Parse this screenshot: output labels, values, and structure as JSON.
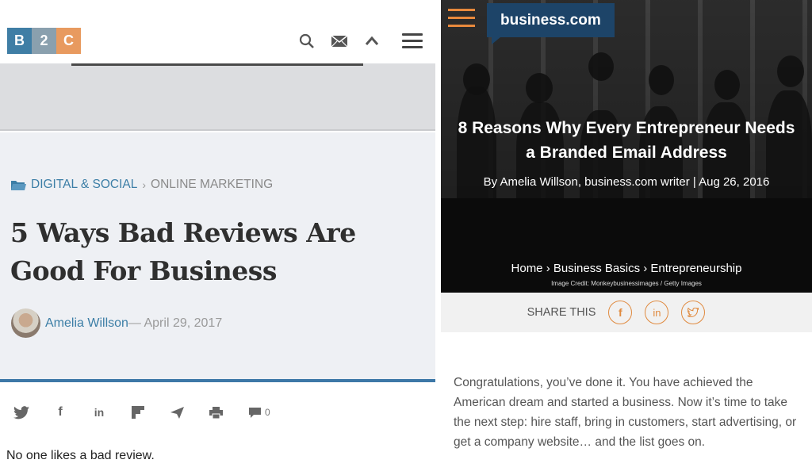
{
  "left": {
    "logo": {
      "b": "B",
      "two": "2",
      "c": "C"
    },
    "header_icons": [
      "search-icon",
      "mail-icon",
      "chevron-up-icon",
      "menu-icon"
    ],
    "breadcrumb": {
      "category": "DIGITAL & SOCIAL",
      "separator": "›",
      "subcategory": "ONLINE MARKETING"
    },
    "headline": "5 Ways Bad Reviews Are Good For Business",
    "author": "Amelia Willson",
    "date": "— April 29, 2017",
    "share_icons": [
      "twitter-icon",
      "facebook-icon",
      "linkedin-icon",
      "flipboard-icon",
      "send-icon",
      "print-icon",
      "comment-icon"
    ],
    "comment_count": "0",
    "teaser": "No one likes a bad review.",
    "colors": {
      "accent": "#3c7ea6",
      "rule": "#3d78a7"
    }
  },
  "right": {
    "brand": "business.com",
    "title": "8 Reasons Why Every Entrepreneur Needs a Branded Email Address",
    "byline": "By Amelia Willson, business.com writer | Aug 26, 2016",
    "breadcrumb": "Home › Business Basics › Entrepreneurship",
    "credit": "Image Credit: Monkeybusinessimages / Getty Images",
    "share_label": "SHARE THIS",
    "share_icons": [
      "facebook-icon",
      "linkedin-icon",
      "twitter-icon"
    ],
    "body": "Congratulations, you’ve done it. You have achieved the American dream and started a business. Now it’s time to take the next step: hire staff, bring in customers, start advertising, or get a company website…  and the list goes on.",
    "colors": {
      "brand_bg": "#1d4468",
      "accent": "#e08a3f"
    }
  }
}
